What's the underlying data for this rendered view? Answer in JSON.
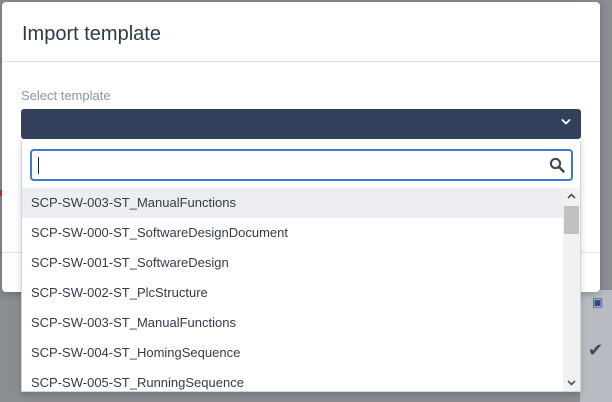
{
  "dialog": {
    "title": "Import template",
    "select_label": "Select template",
    "selected_value": ""
  },
  "dropdown": {
    "search_value": "",
    "items": [
      "SCP-SW-003-ST_ManualFunctions",
      "SCP-SW-000-ST_SoftwareDesignDocument",
      "SCP-SW-001-ST_SoftwareDesign",
      "SCP-SW-002-ST_PlcStructure",
      "SCP-SW-003-ST_ManualFunctions",
      "SCP-SW-004-ST_HomingSequence",
      "SCP-SW-005-ST_RunningSequence"
    ],
    "highlighted_index": 0
  },
  "colors": {
    "select_bg": "#33415c",
    "focus_border": "#3d7ad6",
    "highlight_bg": "#ebedf0"
  },
  "icons": {
    "select": "chevron-down-icon",
    "search": "search-icon",
    "scroll_up": "scroll-up-arrow-icon",
    "scroll_down": "scroll-down-arrow-icon"
  }
}
